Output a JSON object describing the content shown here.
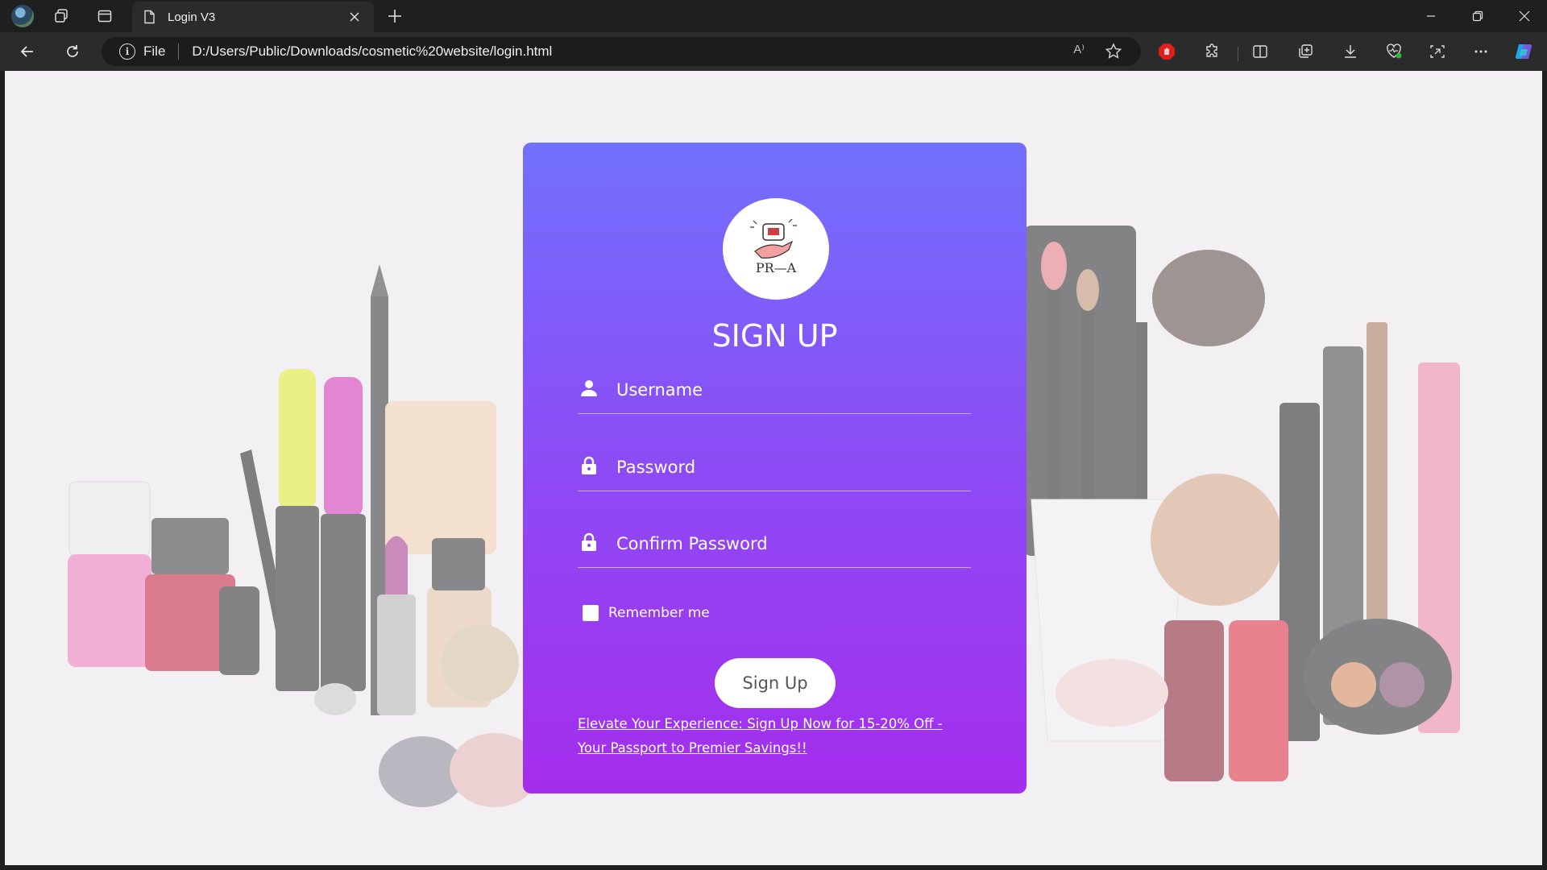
{
  "browser": {
    "tab_title": "Login V3",
    "file_label": "File",
    "url": "D:/Users/Public/Downloads/cosmetic%20website/login.html",
    "read_aloud": "A⁾"
  },
  "form": {
    "title": "SIGN UP",
    "logo_text": "PR—A",
    "username_placeholder": "Username",
    "password_placeholder": "Password",
    "confirm_placeholder": "Confirm Password",
    "remember_label": "Remember me",
    "signup_button": "Sign Up",
    "promo_link": "Elevate Your Experience: Sign Up Now for 15-20% Off - Your Passport to Premier Savings!!"
  },
  "colors": {
    "card_top": "#7270fe",
    "card_bottom": "#a52ded",
    "page_bg": "#f2f0f3"
  }
}
